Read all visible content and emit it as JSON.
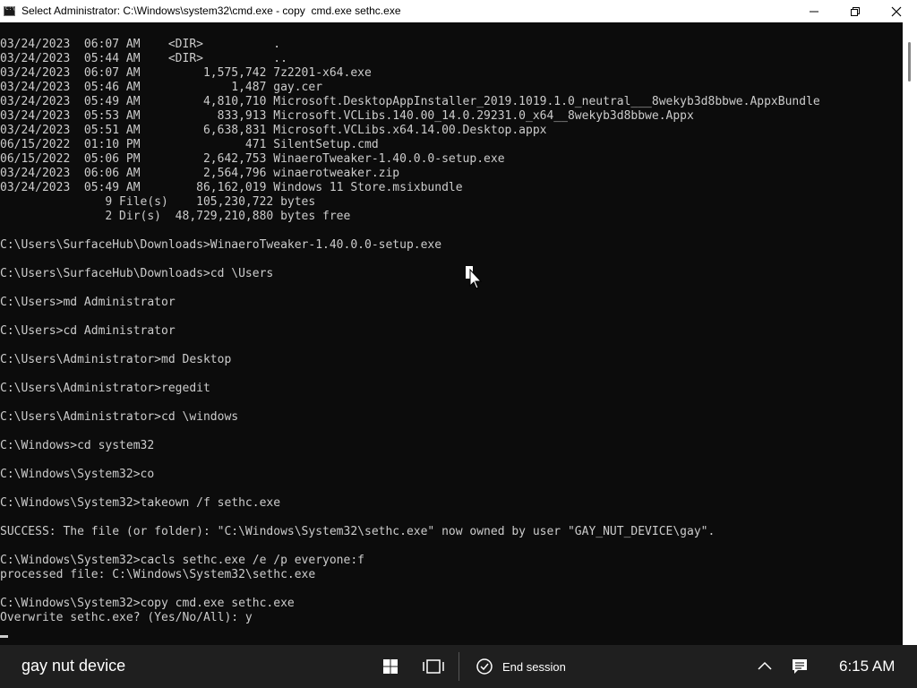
{
  "window": {
    "title": "Select Administrator: C:\\Windows\\system32\\cmd.exe - copy  cmd.exe sethc.exe"
  },
  "console": {
    "lines": [
      "03/24/2023  06:07 AM    <DIR>          .",
      "03/24/2023  05:44 AM    <DIR>          ..",
      "03/24/2023  06:07 AM         1,575,742 7z2201-x64.exe",
      "03/24/2023  05:46 AM             1,487 gay.cer",
      "03/24/2023  05:49 AM         4,810,710 Microsoft.DesktopAppInstaller_2019.1019.1.0_neutral___8wekyb3d8bbwe.AppxBundle",
      "03/24/2023  05:53 AM           833,913 Microsoft.VCLibs.140.00_14.0.29231.0_x64__8wekyb3d8bbwe.Appx",
      "03/24/2023  05:51 AM         6,638,831 Microsoft.VCLibs.x64.14.00.Desktop.appx",
      "06/15/2022  01:10 PM               471 SilentSetup.cmd",
      "06/15/2022  05:06 PM         2,642,753 WinaeroTweaker-1.40.0.0-setup.exe",
      "03/24/2023  06:06 AM         2,564,796 winaerotweaker.zip",
      "03/24/2023  05:49 AM        86,162,019 Windows 11 Store.msixbundle",
      "               9 File(s)    105,230,722 bytes",
      "               2 Dir(s)  48,729,210,880 bytes free",
      "",
      "C:\\Users\\SurfaceHub\\Downloads>WinaeroTweaker-1.40.0.0-setup.exe",
      "",
      "C:\\Users\\SurfaceHub\\Downloads>cd \\Users",
      "",
      "C:\\Users>md Administrator",
      "",
      "C:\\Users>cd Administrator",
      "",
      "C:\\Users\\Administrator>md Desktop",
      "",
      "C:\\Users\\Administrator>regedit",
      "",
      "C:\\Users\\Administrator>cd \\windows",
      "",
      "C:\\Windows>cd system32",
      "",
      "C:\\Windows\\System32>co",
      "",
      "C:\\Windows\\System32>takeown /f sethc.exe",
      "",
      "SUCCESS: The file (or folder): \"C:\\Windows\\System32\\sethc.exe\" now owned by user \"GAY_NUT_DEVICE\\gay\".",
      "",
      "C:\\Windows\\System32>cacls sethc.exe /e /p everyone:f",
      "processed file: C:\\Windows\\System32\\sethc.exe",
      "",
      "C:\\Windows\\System32>copy cmd.exe sethc.exe",
      "Overwrite sethc.exe? (Yes/No/All): y"
    ]
  },
  "taskbar": {
    "device_name": "gay nut device",
    "end_session_label": "End session",
    "clock": "6:15 AM"
  },
  "icons": {
    "start": "windows-start-icon",
    "task_view": "task-view-icon",
    "end_session": "end-session-check-icon",
    "tray_overflow": "chevron-up-icon",
    "notifications": "action-center-icon"
  },
  "colors": {
    "console_bg": "#0c0c0c",
    "console_fg": "#cccccc",
    "titlebar_bg": "#ffffff",
    "taskbar_bg": "#1f1f1f"
  }
}
